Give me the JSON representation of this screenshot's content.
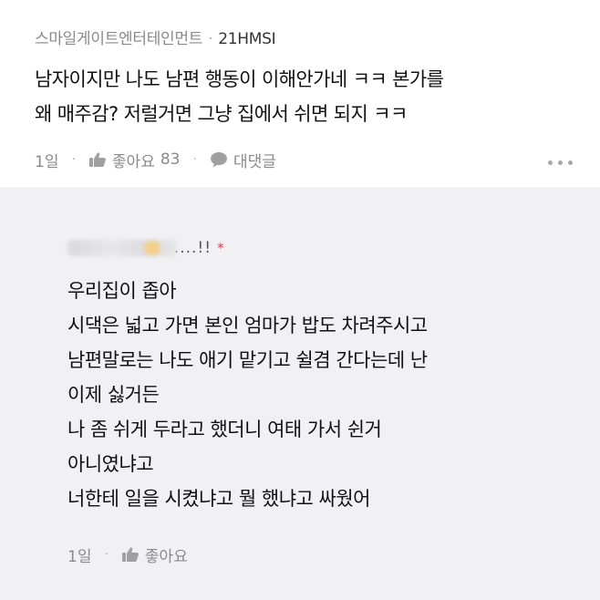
{
  "comment": {
    "author": "스마일게이트엔터테인먼트",
    "separator": "·",
    "author_tag": "21HMSI",
    "lines": [
      "남자이지만 나도 남편 행동이 이해안가네 ㅋㅋ 본가를",
      "왜 매주감? 저럴거면 그냥 집에서 쉬면 되지 ㅋㅋ"
    ],
    "time": "1일",
    "like_label": "좋아요",
    "like_count": "83",
    "reply_label": "대댓글",
    "icons": {
      "like": "thumbs-up-icon",
      "reply": "speech-bubble-icon",
      "more": "more-dots-icon"
    }
  },
  "reply": {
    "author_suffix": "......!!",
    "author_mark": "*",
    "lines": [
      "우리집이 좁아",
      "시댁은 넓고 가면 본인 엄마가 밥도 차려주시고",
      "남편말로는 나도 애기 맡기고 쉴겸 간다는데 난",
      "이제 싫거든",
      "나 좀 쉬게 두라고 했더니 여태 가서 쉰거",
      "아니였냐고",
      "너한테 일을 시켰냐고 뭘 했냐고 싸웠어"
    ],
    "time": "1일",
    "like_label": "좋아요"
  },
  "colors": {
    "background": "#ffffff",
    "reply_background": "#f1f1f4",
    "meta_text": "#8a8a8a",
    "body_text": "#111111",
    "accent_star": "#e0384a"
  }
}
